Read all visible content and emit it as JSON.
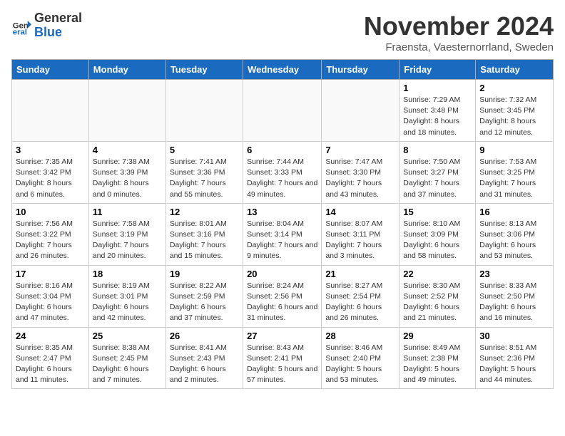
{
  "header": {
    "logo_general": "General",
    "logo_blue": "Blue",
    "month_title": "November 2024",
    "subtitle": "Fraensta, Vaesternorrland, Sweden"
  },
  "weekdays": [
    "Sunday",
    "Monday",
    "Tuesday",
    "Wednesday",
    "Thursday",
    "Friday",
    "Saturday"
  ],
  "weeks": [
    [
      {
        "day": "",
        "detail": ""
      },
      {
        "day": "",
        "detail": ""
      },
      {
        "day": "",
        "detail": ""
      },
      {
        "day": "",
        "detail": ""
      },
      {
        "day": "",
        "detail": ""
      },
      {
        "day": "1",
        "detail": "Sunrise: 7:29 AM\nSunset: 3:48 PM\nDaylight: 8 hours and 18 minutes."
      },
      {
        "day": "2",
        "detail": "Sunrise: 7:32 AM\nSunset: 3:45 PM\nDaylight: 8 hours and 12 minutes."
      }
    ],
    [
      {
        "day": "3",
        "detail": "Sunrise: 7:35 AM\nSunset: 3:42 PM\nDaylight: 8 hours and 6 minutes."
      },
      {
        "day": "4",
        "detail": "Sunrise: 7:38 AM\nSunset: 3:39 PM\nDaylight: 8 hours and 0 minutes."
      },
      {
        "day": "5",
        "detail": "Sunrise: 7:41 AM\nSunset: 3:36 PM\nDaylight: 7 hours and 55 minutes."
      },
      {
        "day": "6",
        "detail": "Sunrise: 7:44 AM\nSunset: 3:33 PM\nDaylight: 7 hours and 49 minutes."
      },
      {
        "day": "7",
        "detail": "Sunrise: 7:47 AM\nSunset: 3:30 PM\nDaylight: 7 hours and 43 minutes."
      },
      {
        "day": "8",
        "detail": "Sunrise: 7:50 AM\nSunset: 3:27 PM\nDaylight: 7 hours and 37 minutes."
      },
      {
        "day": "9",
        "detail": "Sunrise: 7:53 AM\nSunset: 3:25 PM\nDaylight: 7 hours and 31 minutes."
      }
    ],
    [
      {
        "day": "10",
        "detail": "Sunrise: 7:56 AM\nSunset: 3:22 PM\nDaylight: 7 hours and 26 minutes."
      },
      {
        "day": "11",
        "detail": "Sunrise: 7:58 AM\nSunset: 3:19 PM\nDaylight: 7 hours and 20 minutes."
      },
      {
        "day": "12",
        "detail": "Sunrise: 8:01 AM\nSunset: 3:16 PM\nDaylight: 7 hours and 15 minutes."
      },
      {
        "day": "13",
        "detail": "Sunrise: 8:04 AM\nSunset: 3:14 PM\nDaylight: 7 hours and 9 minutes."
      },
      {
        "day": "14",
        "detail": "Sunrise: 8:07 AM\nSunset: 3:11 PM\nDaylight: 7 hours and 3 minutes."
      },
      {
        "day": "15",
        "detail": "Sunrise: 8:10 AM\nSunset: 3:09 PM\nDaylight: 6 hours and 58 minutes."
      },
      {
        "day": "16",
        "detail": "Sunrise: 8:13 AM\nSunset: 3:06 PM\nDaylight: 6 hours and 53 minutes."
      }
    ],
    [
      {
        "day": "17",
        "detail": "Sunrise: 8:16 AM\nSunset: 3:04 PM\nDaylight: 6 hours and 47 minutes."
      },
      {
        "day": "18",
        "detail": "Sunrise: 8:19 AM\nSunset: 3:01 PM\nDaylight: 6 hours and 42 minutes."
      },
      {
        "day": "19",
        "detail": "Sunrise: 8:22 AM\nSunset: 2:59 PM\nDaylight: 6 hours and 37 minutes."
      },
      {
        "day": "20",
        "detail": "Sunrise: 8:24 AM\nSunset: 2:56 PM\nDaylight: 6 hours and 31 minutes."
      },
      {
        "day": "21",
        "detail": "Sunrise: 8:27 AM\nSunset: 2:54 PM\nDaylight: 6 hours and 26 minutes."
      },
      {
        "day": "22",
        "detail": "Sunrise: 8:30 AM\nSunset: 2:52 PM\nDaylight: 6 hours and 21 minutes."
      },
      {
        "day": "23",
        "detail": "Sunrise: 8:33 AM\nSunset: 2:50 PM\nDaylight: 6 hours and 16 minutes."
      }
    ],
    [
      {
        "day": "24",
        "detail": "Sunrise: 8:35 AM\nSunset: 2:47 PM\nDaylight: 6 hours and 11 minutes."
      },
      {
        "day": "25",
        "detail": "Sunrise: 8:38 AM\nSunset: 2:45 PM\nDaylight: 6 hours and 7 minutes."
      },
      {
        "day": "26",
        "detail": "Sunrise: 8:41 AM\nSunset: 2:43 PM\nDaylight: 6 hours and 2 minutes."
      },
      {
        "day": "27",
        "detail": "Sunrise: 8:43 AM\nSunset: 2:41 PM\nDaylight: 5 hours and 57 minutes."
      },
      {
        "day": "28",
        "detail": "Sunrise: 8:46 AM\nSunset: 2:40 PM\nDaylight: 5 hours and 53 minutes."
      },
      {
        "day": "29",
        "detail": "Sunrise: 8:49 AM\nSunset: 2:38 PM\nDaylight: 5 hours and 49 minutes."
      },
      {
        "day": "30",
        "detail": "Sunrise: 8:51 AM\nSunset: 2:36 PM\nDaylight: 5 hours and 44 minutes."
      }
    ]
  ]
}
